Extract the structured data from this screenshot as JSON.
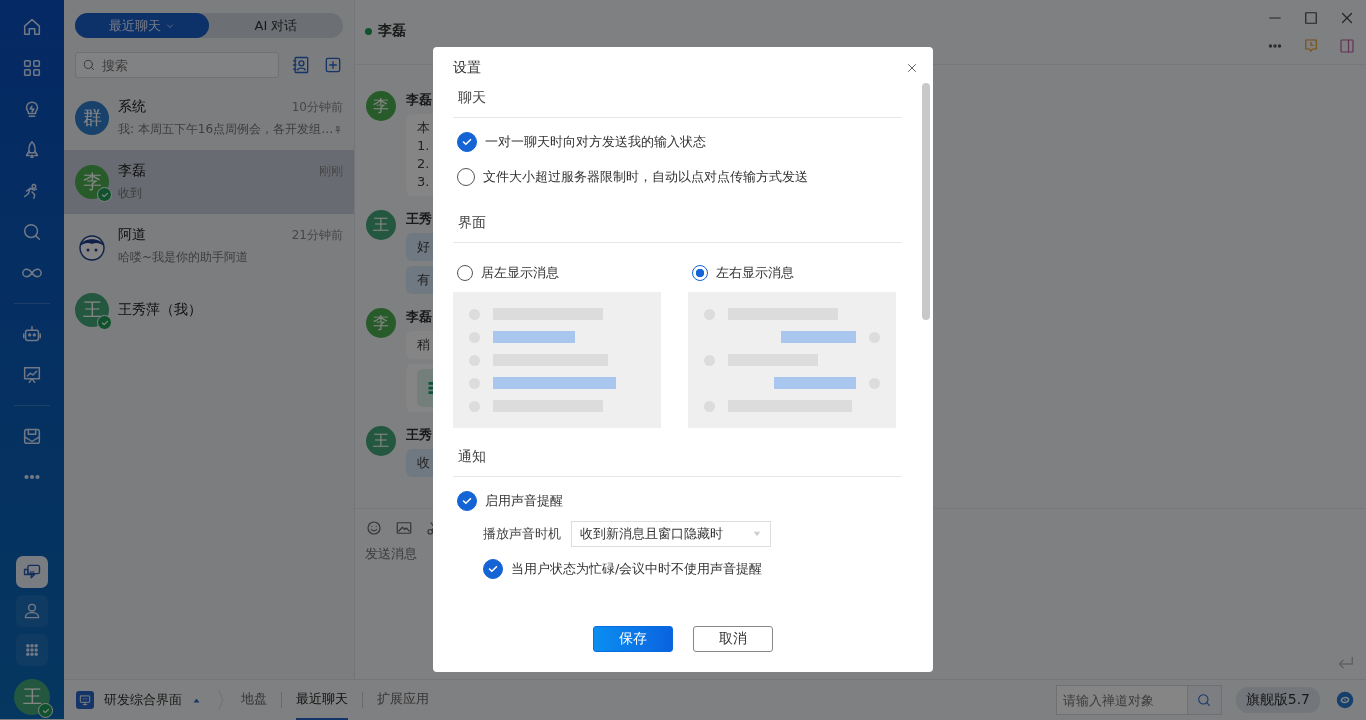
{
  "rail": {
    "items": [
      {
        "kind": "button",
        "selected": false
      },
      {
        "kind": "button",
        "selected": false
      },
      {
        "kind": "button",
        "selected": false
      },
      {
        "kind": "button",
        "selected": false
      },
      {
        "kind": "button",
        "selected": false
      },
      {
        "kind": "button",
        "selected": false
      },
      {
        "kind": "button",
        "selected": false
      },
      {
        "kind": "divider"
      },
      {
        "kind": "button",
        "selected": false
      },
      {
        "kind": "button",
        "selected": false
      },
      {
        "kind": "divider"
      },
      {
        "kind": "button",
        "selected": false
      },
      {
        "kind": "button",
        "selected": false
      }
    ],
    "bottom": [
      {
        "selected": true
      },
      {
        "selected": false
      },
      {
        "selected": false
      }
    ],
    "avatar": {
      "initial": "王",
      "online": true
    }
  },
  "list": {
    "modes": [
      {
        "label": "最近聊天",
        "selected": true,
        "dropdown": true
      },
      {
        "label": "AI 对话",
        "selected": false,
        "dropdown": false
      }
    ],
    "search": {
      "placeholder": "搜索"
    },
    "chats": [
      {
        "kind": "group",
        "avatar": "群",
        "name": "系统",
        "time": "10分钟前",
        "preview": "我: 本周五下午16点周例会，各开发组…",
        "pinned": true,
        "online": false,
        "selected": false
      },
      {
        "kind": "contact",
        "avatar": "李",
        "name": "李磊",
        "time": "刚刚",
        "preview": "收到",
        "pinned": false,
        "online": true,
        "selected": true
      },
      {
        "kind": "bot",
        "name": "阿道",
        "time": "21分钟前",
        "preview": "哈喽~我是你的助手阿道",
        "pinned": false,
        "online": false,
        "selected": false
      },
      {
        "kind": "self",
        "avatar": "王",
        "name": "王秀萍（我）",
        "pinned": false,
        "online": true,
        "selected": false
      }
    ]
  },
  "chat": {
    "title": "李磊",
    "online": true,
    "messages": [
      {
        "avatar": "李",
        "name": "李磊",
        "mine": false,
        "bubbles": [
          {
            "kind": "text",
            "lines": [
              "本",
              "1.",
              "2.",
              "3."
            ]
          }
        ]
      },
      {
        "avatar": "王",
        "name": "王秀",
        "mine": true,
        "bubbles": [
          {
            "kind": "text",
            "lines": [
              "好"
            ]
          },
          {
            "kind": "text",
            "lines": [
              "有"
            ]
          }
        ]
      },
      {
        "avatar": "李",
        "name": "李磊",
        "mine": false,
        "bubbles": [
          {
            "kind": "text",
            "lines": [
              "稍"
            ]
          },
          {
            "kind": "file"
          }
        ]
      },
      {
        "avatar": "王",
        "name": "王秀",
        "mine": true,
        "bubbles": [
          {
            "kind": "text",
            "lines": [
              "收"
            ]
          }
        ]
      }
    ],
    "input": {
      "placeholder": "发送消息"
    }
  },
  "bottom_bar": {
    "workspace": "研发综合界面",
    "tabs": [
      {
        "label": "地盘",
        "selected": false
      },
      {
        "label": "最近聊天",
        "selected": true
      },
      {
        "label": "扩展应用",
        "selected": false
      }
    ],
    "search": {
      "placeholder": "请输入禅道对象"
    },
    "edition": "旗舰版5.7"
  },
  "dialog": {
    "title": "设置",
    "sections": [
      {
        "title": "聊天",
        "items": [
          {
            "kind": "check",
            "label": "一对一聊天时向对方发送我的输入状态",
            "checked": true
          },
          {
            "kind": "check",
            "label": "文件大小超过服务器限制时，自动以点对点传输方式发送",
            "checked": false
          }
        ]
      },
      {
        "title": "界面",
        "items": [
          {
            "kind": "layouts",
            "options": [
              {
                "kind": "left",
                "label": "居左显示消息",
                "selected": false
              },
              {
                "kind": "sides",
                "label": "左右显示消息",
                "selected": true
              }
            ]
          }
        ]
      },
      {
        "title": "通知",
        "items": [
          {
            "kind": "check",
            "label": "启用声音提醒",
            "checked": true
          },
          {
            "kind": "select",
            "label": "播放声音时机",
            "value": "收到新消息且窗口隐藏时"
          },
          {
            "kind": "subcheck",
            "label": "当用户状态为忙碌/会议中时不使用声音提醒",
            "checked": true
          }
        ]
      }
    ],
    "buttons": [
      {
        "label": "保存",
        "primary": true
      },
      {
        "label": "取消",
        "primary": false
      }
    ]
  }
}
